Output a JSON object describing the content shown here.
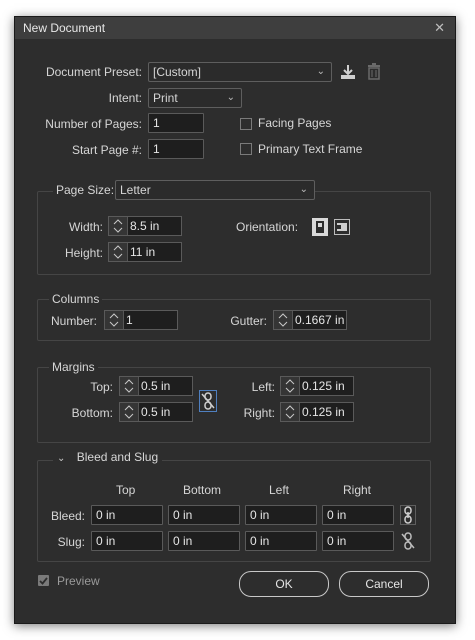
{
  "window": {
    "title": "New Document",
    "close_glyph": "✕"
  },
  "document": {
    "preset_label": "Document Preset:",
    "preset_value": "[Custom]",
    "intent_label": "Intent:",
    "intent_value": "Print",
    "pages_label": "Number of Pages:",
    "pages_value": "1",
    "start_label": "Start Page #:",
    "start_value": "1",
    "facing_label": "Facing Pages",
    "facing_checked": false,
    "primary_label": "Primary Text Frame",
    "primary_checked": false
  },
  "page_size": {
    "label": "Page Size:",
    "value": "Letter",
    "width_label": "Width:",
    "width_value": "8.5 in",
    "height_label": "Height:",
    "height_value": "11 in",
    "orientation_label": "Orientation:"
  },
  "columns": {
    "title": "Columns",
    "number_label": "Number:",
    "number_value": "1",
    "gutter_label": "Gutter:",
    "gutter_value": "0.1667 in"
  },
  "margins": {
    "title": "Margins",
    "top_label": "Top:",
    "top_value": "0.5 in",
    "bottom_label": "Bottom:",
    "bottom_value": "0.5 in",
    "left_label": "Left:",
    "left_value": "0.125 in",
    "right_label": "Right:",
    "right_value": "0.125 in"
  },
  "bleed_slug": {
    "title": "Bleed and Slug",
    "col_top": "Top",
    "col_bottom": "Bottom",
    "col_left": "Left",
    "col_right": "Right",
    "bleed_label": "Bleed:",
    "slug_label": "Slug:",
    "bleed_values": [
      "0 in",
      "0 in",
      "0 in",
      "0 in"
    ],
    "slug_values": [
      "0 in",
      "0 in",
      "0 in",
      "0 in"
    ]
  },
  "footer": {
    "preview_label": "Preview",
    "preview_checked": true,
    "ok_label": "OK",
    "cancel_label": "Cancel"
  },
  "colors": {
    "dialog_bg": "#2d2d2d",
    "field_bg": "#1e1e1e",
    "text": "#d6d6d6",
    "titlebar": "#3e3e3e"
  }
}
